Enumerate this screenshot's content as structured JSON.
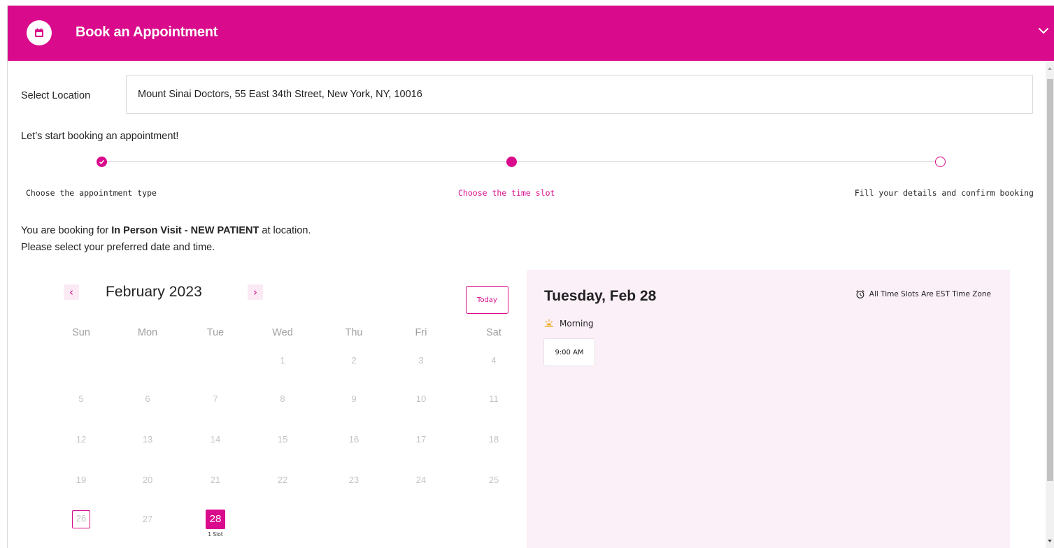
{
  "header": {
    "title": "Book an Appointment",
    "icon": "calendar-icon",
    "collapse_icon": "chevron-down-icon",
    "bg_color": "#d90b8c"
  },
  "location": {
    "label": "Select Location",
    "value": "Mount Sinai Doctors, 55 East 34th Street, New York, NY, 10016"
  },
  "intro": "Let’s start booking an appointment!",
  "steps": [
    {
      "label": "Choose the appointment type",
      "state": "done"
    },
    {
      "label": "Choose the time slot",
      "state": "active"
    },
    {
      "label": "Fill your details and confirm booking",
      "state": "todo"
    }
  ],
  "booking": {
    "prefix": "You are booking for ",
    "visit_type": "In Person Visit - NEW PATIENT",
    "suffix": " at location.",
    "line2": "Please select your preferred date and time."
  },
  "calendar": {
    "prev_icon": "chevron-left-icon",
    "next_icon": "chevron-right-icon",
    "prev_glyph": "‹",
    "next_glyph": "›",
    "month_label": "February 2023",
    "today_label": "Today",
    "weekdays": [
      "Sun",
      "Mon",
      "Tue",
      "Wed",
      "Thu",
      "Fri",
      "Sat"
    ],
    "weeks": [
      [
        "",
        "",
        "",
        "1",
        "2",
        "3",
        "4"
      ],
      [
        "5",
        "6",
        "7",
        "8",
        "9",
        "10",
        "11"
      ],
      [
        "12",
        "13",
        "14",
        "15",
        "16",
        "17",
        "18"
      ],
      [
        "19",
        "20",
        "21",
        "22",
        "23",
        "24",
        "25"
      ],
      [
        "26",
        "27",
        "28",
        "",
        "",
        "",
        ""
      ]
    ],
    "today_date": "26",
    "selected_date": "28",
    "selected_slots": "1 Slot"
  },
  "times": {
    "date_title": "Tuesday, Feb 28",
    "timezone_icon": "alarm-clock-icon",
    "timezone_note": "All Time Slots Are EST Time Zone",
    "periods": [
      {
        "name": "Morning",
        "icon": "sunrise-icon",
        "slots": [
          "9:00 AM"
        ]
      }
    ],
    "panel_color": "#fcf0f8"
  },
  "colors": {
    "accent": "#d90b8c",
    "muted_text": "#c4c4c4"
  }
}
